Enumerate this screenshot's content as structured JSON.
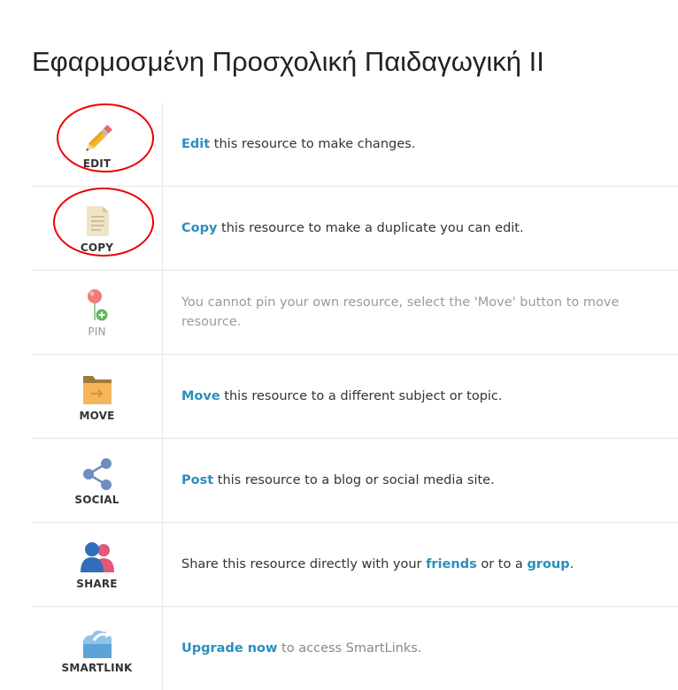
{
  "page": {
    "title": "Εφαρμοσμένη Προσχολική Παιδαγωγική ΙΙ"
  },
  "actions": [
    {
      "icon": "pencil-icon",
      "label": "EDIT",
      "link": "Edit",
      "rest": " this resource to make changes."
    },
    {
      "icon": "document-icon",
      "label": "COPY",
      "link": "Copy",
      "rest": " this resource to make a duplicate you can edit."
    },
    {
      "icon": "pin-icon",
      "label": "PIN",
      "text": "You cannot pin your own resource, select the 'Move' button to move resource."
    },
    {
      "icon": "folder-icon",
      "label": "MOVE",
      "link": "Move",
      "rest": " this resource to a different subject or topic."
    },
    {
      "icon": "share-nodes-icon",
      "label": "SOCIAL",
      "link": "Post",
      "rest": " this resource to a blog or social media site."
    },
    {
      "icon": "people-icon",
      "label": "SHARE",
      "pre": "Share this resource directly with your ",
      "link1": "friends",
      "mid": " or to a ",
      "link2": "group",
      "post": "."
    },
    {
      "icon": "cloud-link-icon",
      "label": "SMARTLINK",
      "link": "Upgrade now",
      "rest": " to access SmartLinks."
    }
  ],
  "colors": {
    "link": "#2a8fbd",
    "annotation": "#ee0000"
  }
}
